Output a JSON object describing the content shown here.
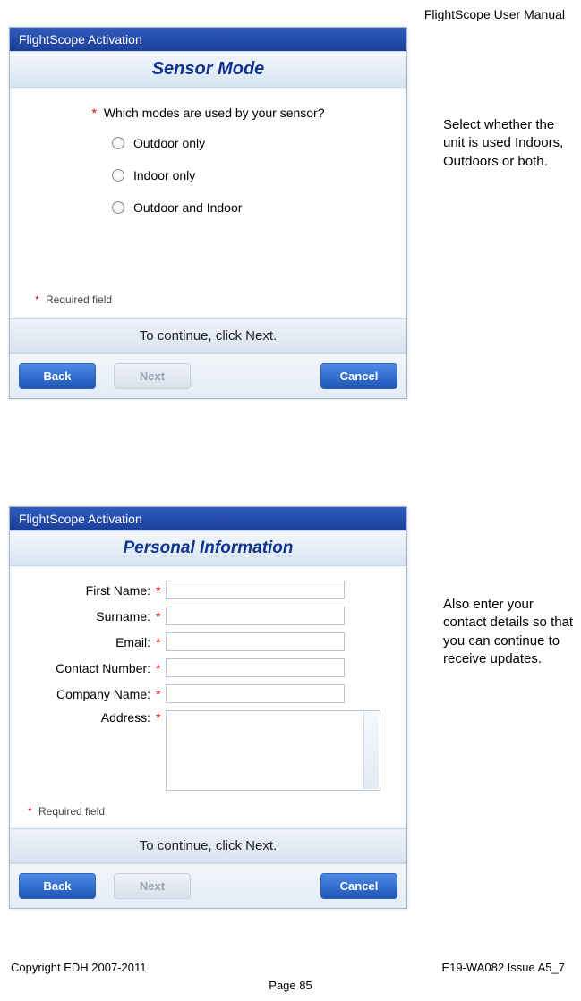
{
  "header": {
    "doc_title": "FlightScope User Manual"
  },
  "dialog1": {
    "title": "FlightScope Activation",
    "section": "Sensor Mode",
    "question": "Which modes are used by your sensor?",
    "options": [
      "Outdoor only",
      "Indoor only",
      "Outdoor and Indoor"
    ],
    "required_note": "Required field",
    "continue_text": "To continue, click Next.",
    "buttons": {
      "back": "Back",
      "next": "Next",
      "cancel": "Cancel"
    }
  },
  "side1": "Select whether the unit is used Indoors, Outdoors or both.",
  "dialog2": {
    "title": "FlightScope Activation",
    "section": "Personal Information",
    "fields": {
      "first_name": "First Name:",
      "surname": "Surname:",
      "email": "Email:",
      "contact_number": "Contact Number:",
      "company_name": "Company Name:",
      "address": "Address:"
    },
    "required_note": "Required field",
    "continue_text": "To continue, click Next.",
    "buttons": {
      "back": "Back",
      "next": "Next",
      "cancel": "Cancel"
    }
  },
  "side2": "Also enter your contact details so that you can continue to receive updates.",
  "footer": {
    "copyright": "Copyright EDH 2007-2011",
    "issue": "E19-WA082 Issue A5_7",
    "page": "Page 85"
  },
  "glyphs": {
    "asterisk": "*"
  }
}
